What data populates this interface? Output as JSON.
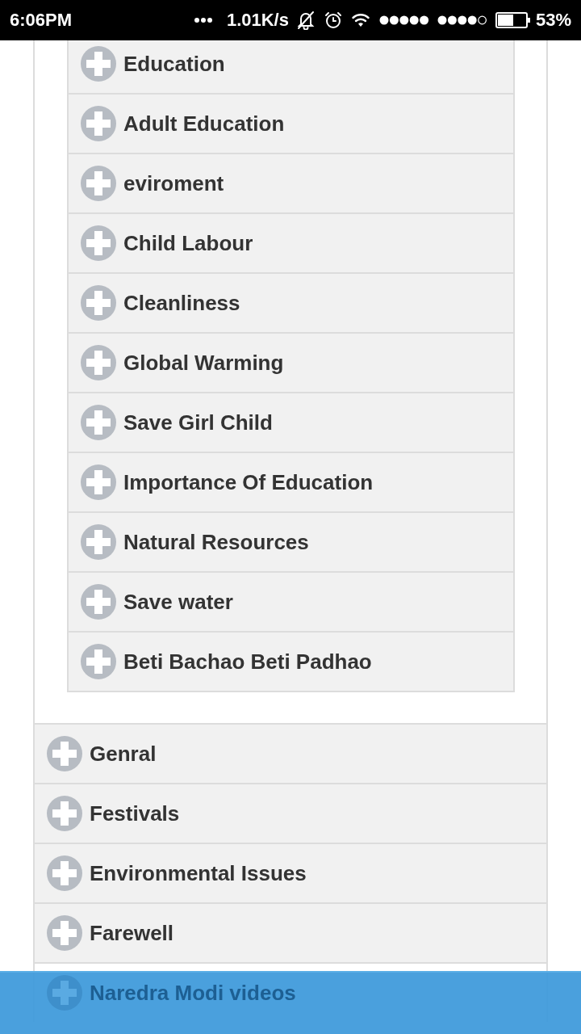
{
  "status_bar": {
    "time": "6:06PM",
    "network_speed": "1.01K/s",
    "battery_percent": "53%"
  },
  "accordion": {
    "open_section": {
      "items": [
        {
          "label": "Education",
          "expanded": false
        },
        {
          "label": "Adult Education",
          "expanded": false
        },
        {
          "label": "eviroment",
          "expanded": false
        },
        {
          "label": "Child Labour",
          "expanded": false
        },
        {
          "label": "Cleanliness",
          "expanded": false
        },
        {
          "label": "Global Warming",
          "expanded": false
        },
        {
          "label": "Save Girl Child",
          "expanded": false
        },
        {
          "label": "Importance Of Education",
          "expanded": false
        },
        {
          "label": "Natural Resources",
          "expanded": false
        },
        {
          "label": "Save water",
          "expanded": false
        },
        {
          "label": "Beti Bachao Beti Padhao",
          "expanded": false
        }
      ]
    },
    "sections": [
      {
        "label": "Genral",
        "expanded": false
      },
      {
        "label": "Festivals",
        "expanded": false
      },
      {
        "label": "Environmental Issues",
        "expanded": false
      },
      {
        "label": "Farewell",
        "expanded": false
      },
      {
        "label": "Naredra Modi videos",
        "expanded": false
      }
    ]
  }
}
